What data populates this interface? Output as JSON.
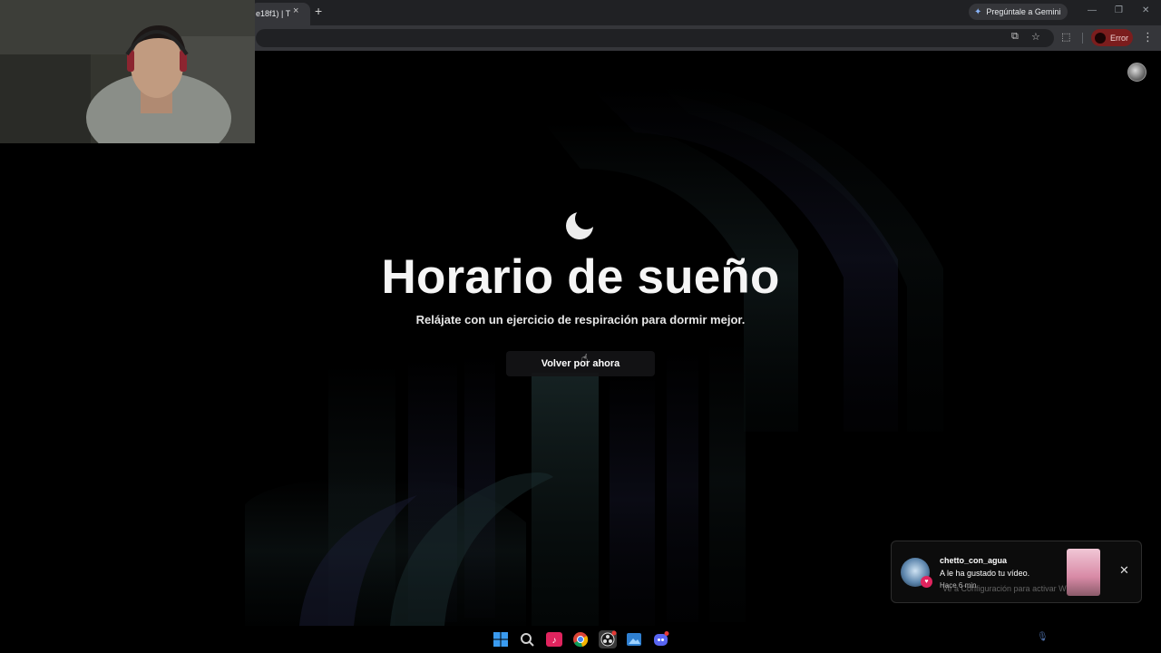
{
  "browser": {
    "tab_title": "e18f1) | T",
    "tab_close": "×",
    "new_tab": "+",
    "gemini_label": "Pregúntale a Gemini",
    "error_label": "Error",
    "window_controls": [
      "—",
      "❐",
      "✕"
    ]
  },
  "page": {
    "title": "Horario de sueño",
    "subtitle": "Relájate con un ejercicio de respiración para dormir mejor.",
    "back_button": "Volver por ahora",
    "icon": "moon-icon"
  },
  "notification": {
    "username": "chetto_con_agua",
    "message": "A le ha gustado tu vídeo.",
    "time": "Hace 6 min",
    "watermark": "Ve a Configuración para activar Windows.",
    "close": "✕"
  },
  "taskbar": {
    "apps": [
      "windows-start-icon",
      "search-icon",
      "tiktok-icon",
      "chrome-icon",
      "obs-icon",
      "photos-icon",
      "discord-icon"
    ]
  },
  "colors": {
    "background": "#000000",
    "error_pill": "#7b1d1d",
    "notification_heart": "#e0245e"
  }
}
